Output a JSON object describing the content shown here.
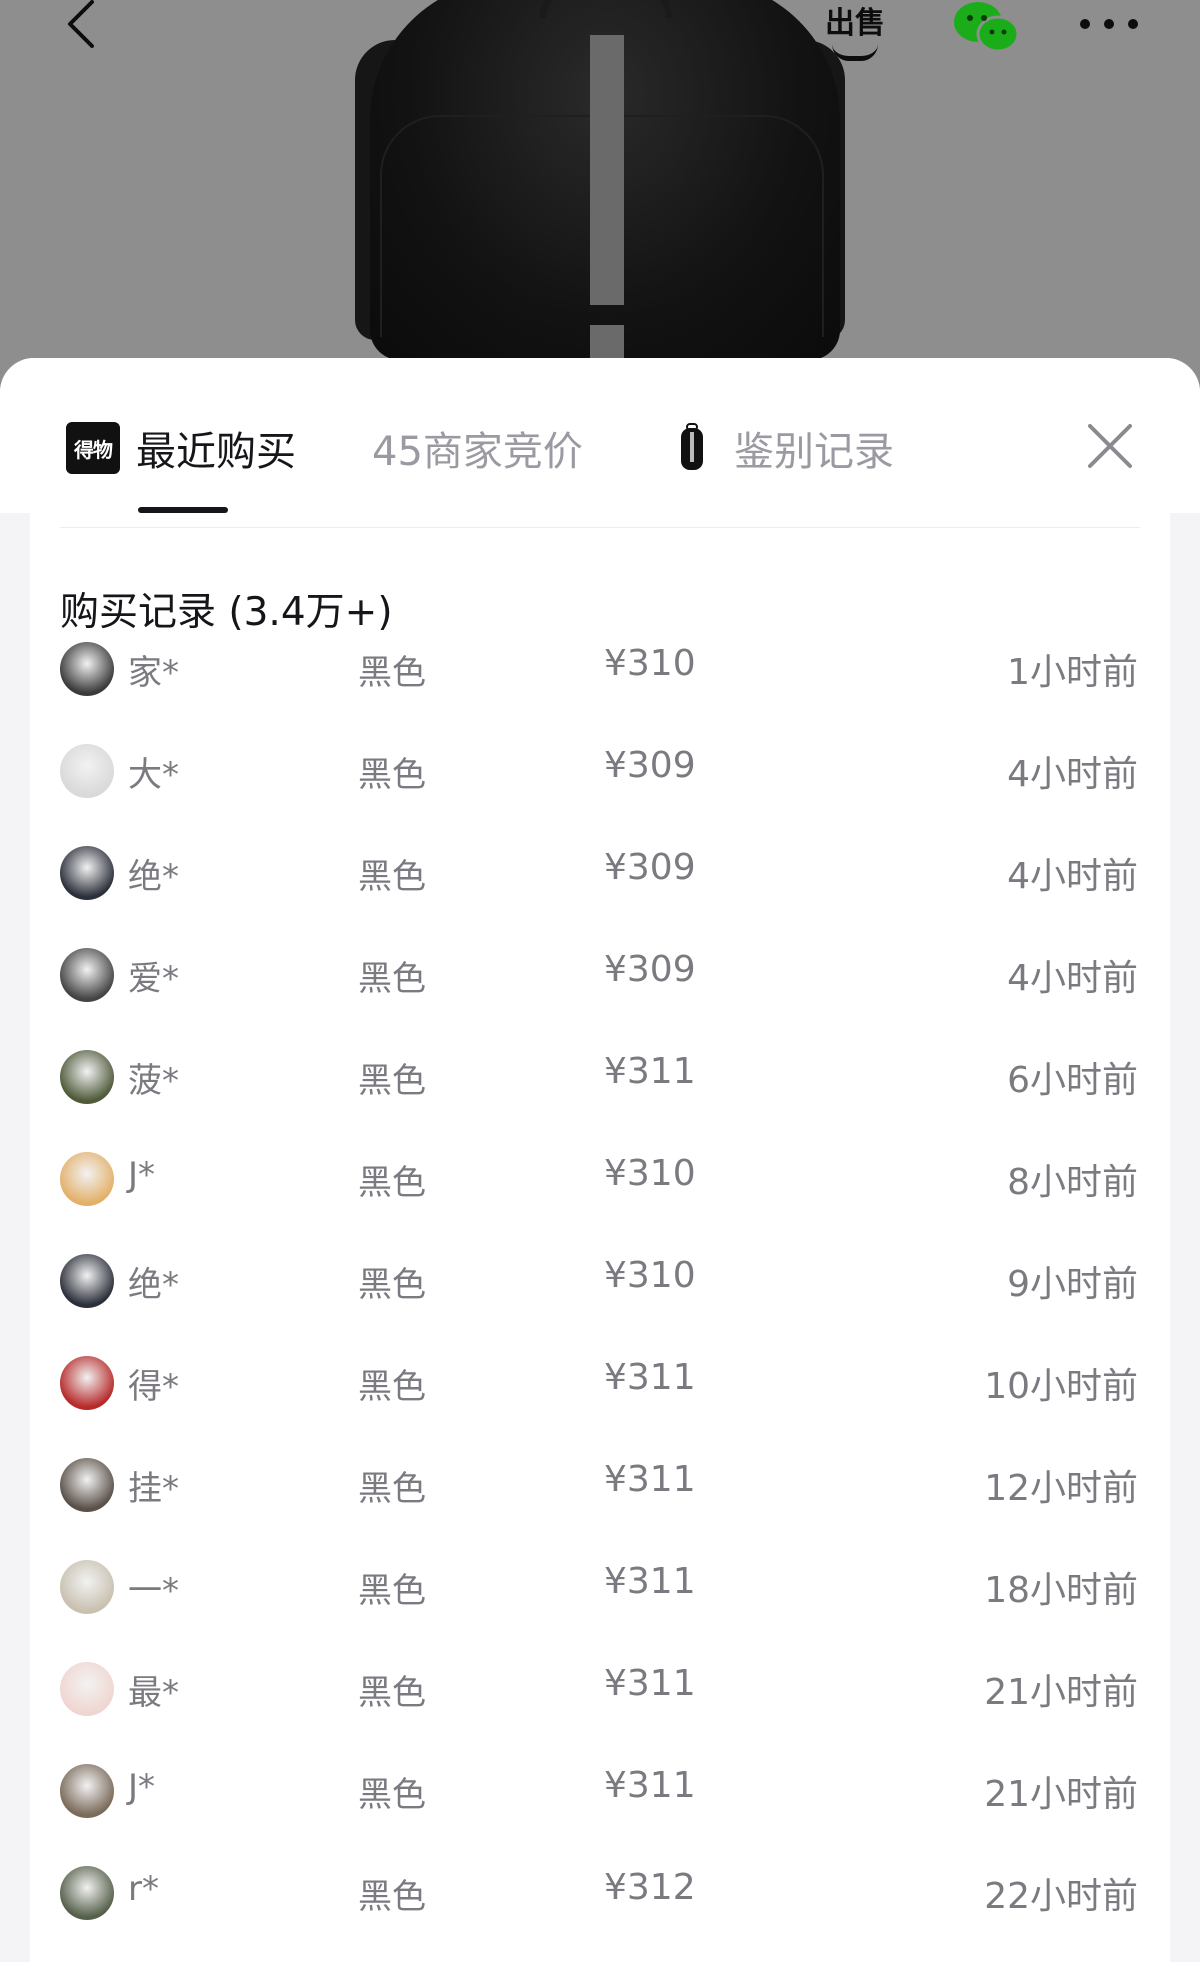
{
  "nav": {
    "sell_label": "出售"
  },
  "tabs": [
    {
      "label": "最近购买",
      "logo_text": "得物"
    },
    {
      "label": "45商家竞价"
    },
    {
      "label": "鉴别记录"
    }
  ],
  "section": {
    "title": "购买记录 (3.4万+)"
  },
  "records": [
    {
      "user": "家*",
      "color": "黑色",
      "price": "¥310",
      "time": "1小时前",
      "avatar": "#3a3a3a"
    },
    {
      "user": "大*",
      "color": "黑色",
      "price": "¥309",
      "time": "4小时前",
      "avatar": "#d9d9d9"
    },
    {
      "user": "绝*",
      "color": "黑色",
      "price": "¥309",
      "time": "4小时前",
      "avatar": "#2b2f3a"
    },
    {
      "user": "爱*",
      "color": "黑色",
      "price": "¥309",
      "time": "4小时前",
      "avatar": "#444444"
    },
    {
      "user": "菠*",
      "color": "黑色",
      "price": "¥311",
      "time": "6小时前",
      "avatar": "#4f5a3a"
    },
    {
      "user": "J*",
      "color": "黑色",
      "price": "¥310",
      "time": "8小时前",
      "avatar": "#e3b06a"
    },
    {
      "user": "绝*",
      "color": "黑色",
      "price": "¥310",
      "time": "9小时前",
      "avatar": "#2b2f3a"
    },
    {
      "user": "得*",
      "color": "黑色",
      "price": "¥311",
      "time": "10小时前",
      "avatar": "#b62a2a"
    },
    {
      "user": "挂*",
      "color": "黑色",
      "price": "¥311",
      "time": "12小时前",
      "avatar": "#5a5048"
    },
    {
      "user": "一*",
      "color": "黑色",
      "price": "¥311",
      "time": "18小时前",
      "avatar": "#c9c1b0"
    },
    {
      "user": "最*",
      "color": "黑色",
      "price": "¥311",
      "time": "21小时前",
      "avatar": "#f0d6d0"
    },
    {
      "user": "J*",
      "color": "黑色",
      "price": "¥311",
      "time": "21小时前",
      "avatar": "#7a6a5a"
    },
    {
      "user": "r*",
      "color": "黑色",
      "price": "¥312",
      "time": "22小时前",
      "avatar": "#55604a"
    }
  ]
}
